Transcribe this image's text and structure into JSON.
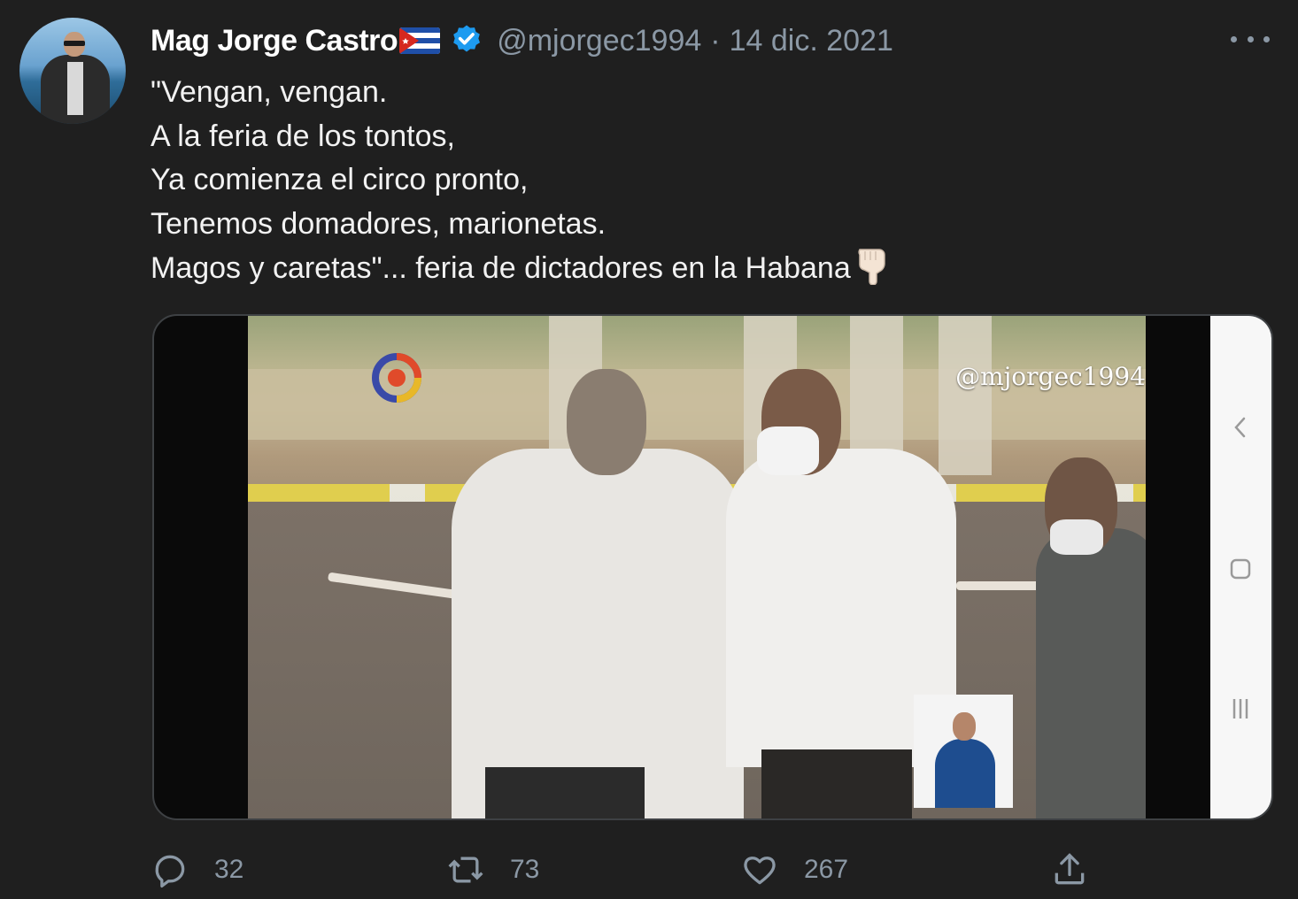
{
  "tweet": {
    "author": {
      "display_name": "Mag Jorge Castro",
      "flag_icon": "cuba-flag-icon",
      "verified_icon": "verified-badge-icon",
      "handle": "@mjorgec1994",
      "separator": "·",
      "date": "14 dic. 2021"
    },
    "lines": [
      "\"Vengan, vengan.",
      "A la feria de los tontos,",
      "Ya comienza el circo pronto,",
      "Tenemos domadores, marionetas.",
      "Magos y caretas\"... feria de dictadores en la Habana"
    ],
    "emoji_icon": "backhand-index-pointing-down-icon",
    "media": {
      "watermark": "@mjorgec1994",
      "nav_icons": [
        "back-chevron-icon",
        "home-square-icon",
        "recents-lines-icon"
      ]
    },
    "actions": {
      "replies": "32",
      "retweets": "73",
      "likes": "267"
    },
    "colors": {
      "background": "#1f1f1f",
      "text": "#e7e9ea",
      "muted": "#8b98a5",
      "verified": "#1d9bf0"
    }
  }
}
